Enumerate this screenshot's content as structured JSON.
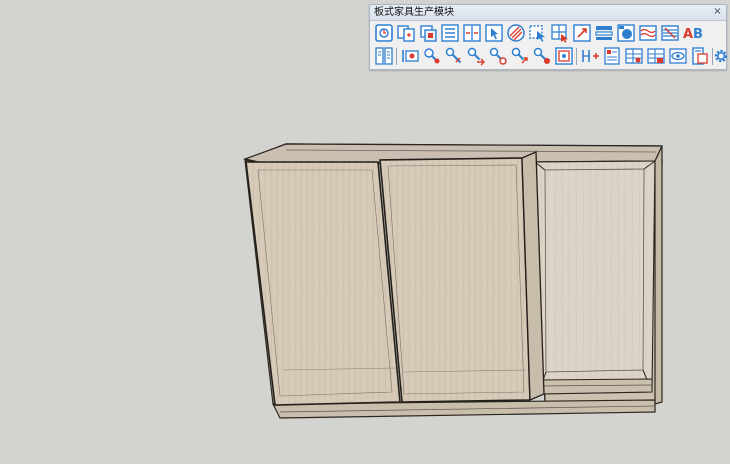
{
  "toolbar": {
    "title": "板式家具生产模块",
    "close_glyph": "×",
    "row1_icons": [
      "panel-info-icon",
      "panel-copy-icon",
      "panel-stack-icon",
      "list-icon",
      "split-panel-icon",
      "cursor-select-icon",
      "hatch-icon",
      "select-edge-icon",
      "grid-cursor-icon",
      "rotate-arrow-icon",
      "layers-icon",
      "circle-frame-icon",
      "wave-panel-icon",
      "striped-panel-icon",
      "text-ab-icon"
    ],
    "row2_icons": [
      "book-icon",
      "hinge-icon",
      "drill-hole-icon",
      "drill-tool-icon",
      "drill-move-icon",
      "drill-angle-icon",
      "drill-swap-icon",
      "drill-delete-icon",
      "drill-frame-icon",
      "connector-add-icon",
      "cut-list-icon",
      "panel-table-icon",
      "panel-table-red-icon",
      "eye-view-icon",
      "export-panel-icon",
      "gear-icon"
    ],
    "text_icon_letters": "AB"
  },
  "colors": {
    "viewport_bg": "#d3d3d0",
    "toolbar_bg": "#f0f0f0",
    "icon_blue": "#2f7fd1",
    "icon_red": "#d93a2b",
    "wood": "#d6c8b6"
  }
}
